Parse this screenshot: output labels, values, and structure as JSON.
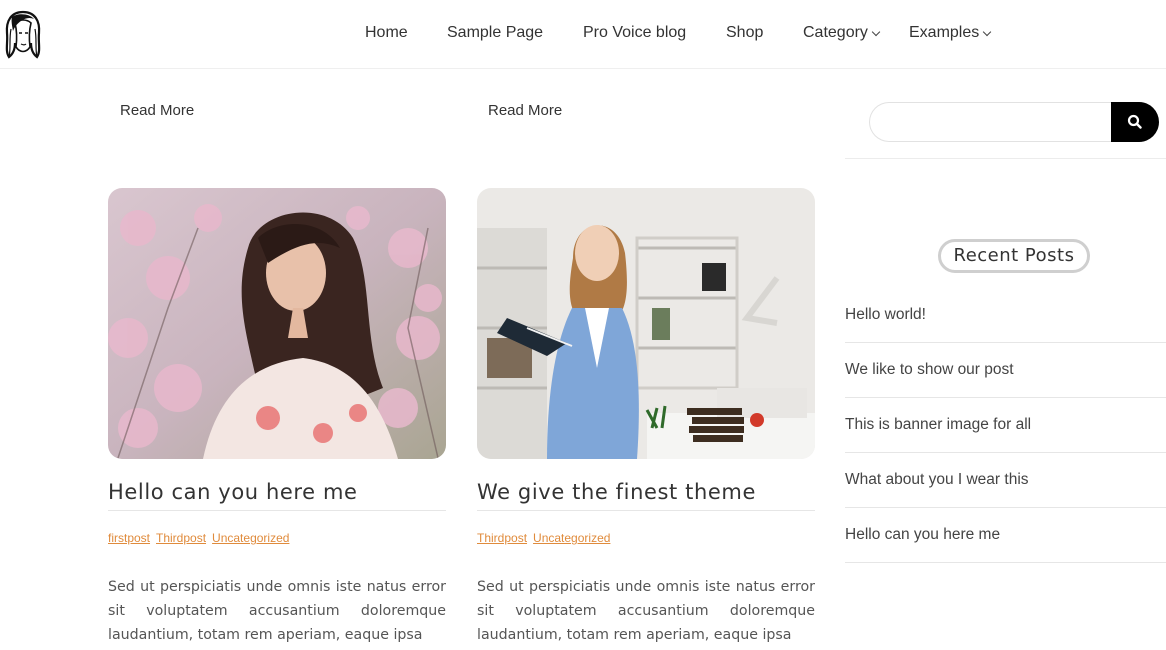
{
  "nav": {
    "items": [
      {
        "label": "Home"
      },
      {
        "label": "Sample Page"
      },
      {
        "label": "Pro Voice blog"
      },
      {
        "label": "Shop"
      },
      {
        "label": "Category",
        "dropdown": true
      },
      {
        "label": "Examples",
        "dropdown": true
      }
    ]
  },
  "read_more": [
    "Read More",
    "Read More"
  ],
  "posts": [
    {
      "title": "Hello can you here me",
      "tags": [
        "firstpost",
        "Thirdpost",
        "Uncategorized"
      ],
      "excerpt": "Sed ut perspiciatis unde omnis iste natus error sit voluptatem accusantium doloremque laudantium, totam rem aperiam, eaque ipsa"
    },
    {
      "title": "We give the finest theme",
      "tags": [
        "Thirdpost",
        "Uncategorized"
      ],
      "excerpt": "Sed ut perspiciatis unde omnis iste natus error sit voluptatem accusantium doloremque laudantium, totam rem aperiam, eaque ipsa"
    }
  ],
  "sidebar": {
    "search": {
      "placeholder": "",
      "icon": "search-icon"
    },
    "recent_posts": {
      "title": "Recent Posts",
      "items": [
        {
          "label": "Hello world!"
        },
        {
          "label": "We like to show our post"
        },
        {
          "label": "This is banner image for all"
        },
        {
          "label": "What about you I wear this"
        },
        {
          "label": "Hello can you here me"
        }
      ]
    }
  },
  "colors": {
    "tag": "#e08b3c",
    "search_button": "#000000"
  }
}
